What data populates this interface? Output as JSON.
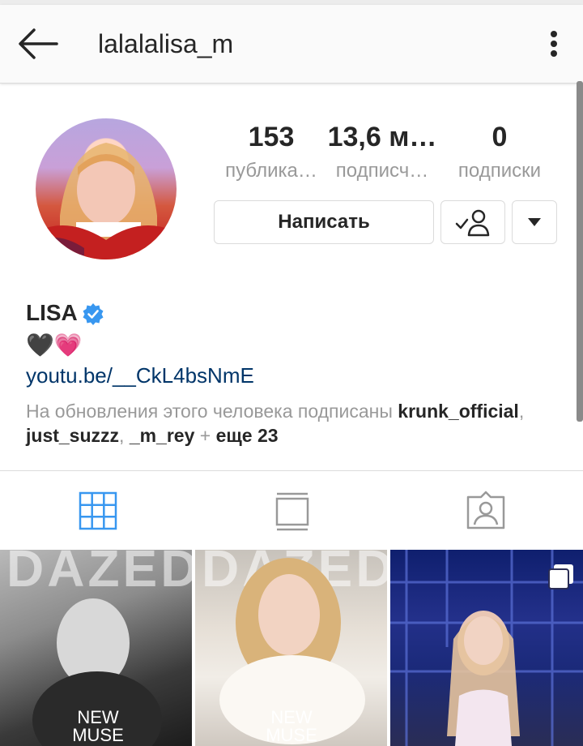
{
  "header": {
    "username": "lalalalisa_m"
  },
  "profile": {
    "stats": [
      {
        "value": "153",
        "label": "публика…"
      },
      {
        "value": "13,6 м…",
        "label": "подписч…"
      },
      {
        "value": "0",
        "label": "подписки"
      }
    ],
    "message_button": "Написать",
    "name": "LISA",
    "bio": "🖤💗",
    "link": "youtu.be/__CkL4bsNmE",
    "followed_by": {
      "prefix": "На обновления этого человека подписаны ",
      "user1": "krunk_official",
      "sep1": ", ",
      "user2": "just_suzzz",
      "sep2": ", ",
      "user3": "_m_rey",
      "sep3": " + ",
      "more": "еще 23"
    }
  },
  "tabs": [
    "grid-icon",
    "feed-icon",
    "tagged-icon"
  ],
  "active_tab": "grid",
  "colors": {
    "accent": "#3897f0",
    "link": "#003569",
    "muted": "#999999"
  },
  "photos": [
    {
      "masthead": "DAZED",
      "caption_line1": "NEW",
      "caption_line2": "MUSE"
    },
    {
      "masthead": "DAZED",
      "caption_line1": "NEW",
      "caption_line2": "MUSE"
    },
    {
      "multi": true
    }
  ]
}
